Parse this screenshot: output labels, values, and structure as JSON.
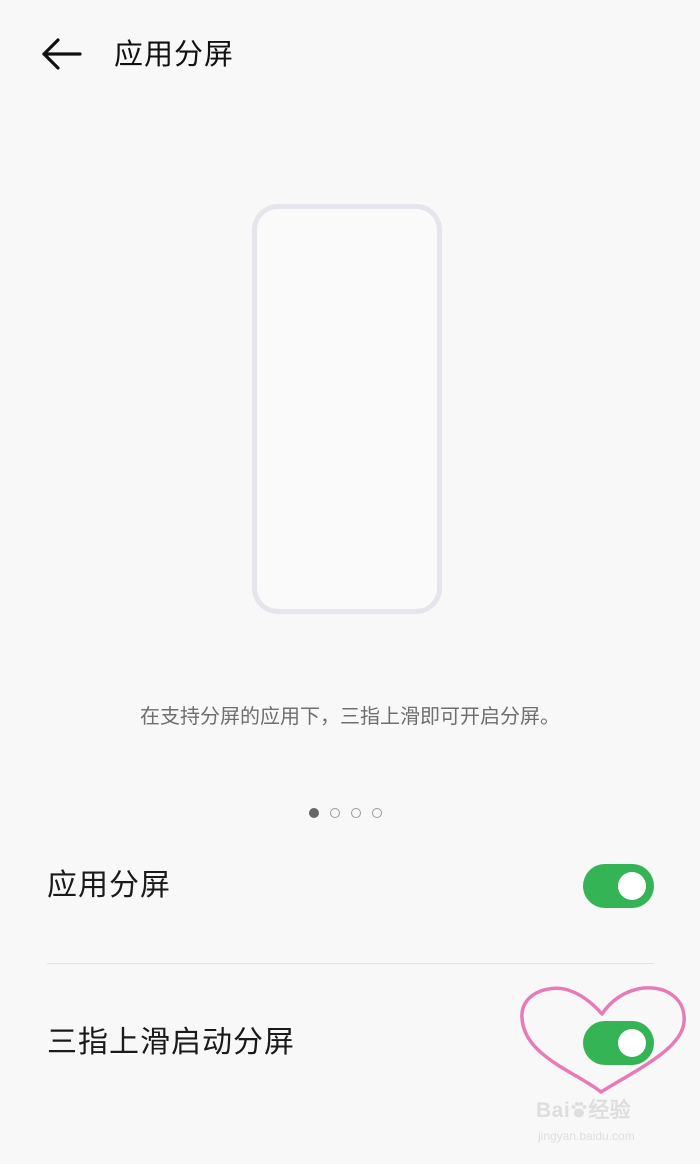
{
  "header": {
    "back_icon": "arrow-left-icon",
    "title": "应用分屏"
  },
  "illustration": {
    "icon": "phone-outline-icon"
  },
  "description": "在支持分屏的应用下，三指上滑即可开启分屏。",
  "pager": {
    "count": 4,
    "active_index": 0
  },
  "settings": [
    {
      "label": "应用分屏",
      "enabled": true
    },
    {
      "label": "三指上滑启动分屏",
      "enabled": true
    }
  ],
  "colors": {
    "toggle_on": "#35b455",
    "annotation_heart": "#e77bb6",
    "background": "#f8f8f8"
  },
  "watermark": {
    "line1_prefix": "Bai",
    "line1_paw": "paw-icon",
    "line1_suffix": "经验",
    "line2": "jingyan.baidu.com"
  }
}
